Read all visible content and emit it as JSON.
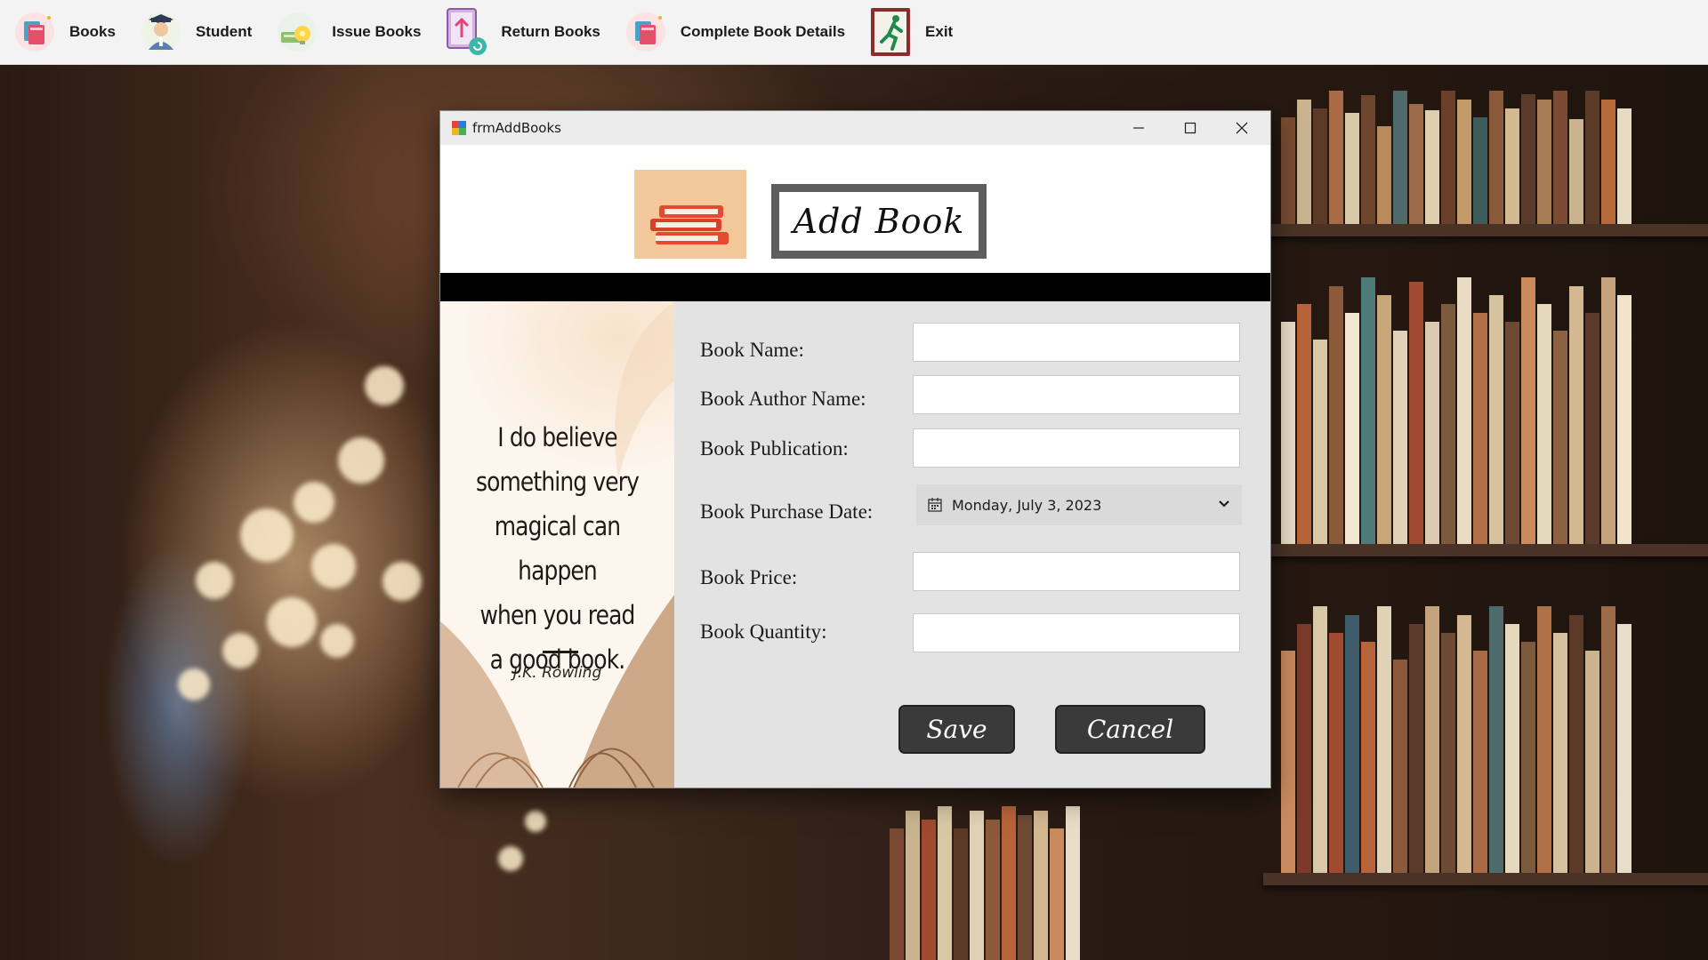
{
  "toolbar": {
    "items": [
      {
        "label": "Books",
        "icon": "books-icon"
      },
      {
        "label": "Student",
        "icon": "student-icon"
      },
      {
        "label": "Issue Books",
        "icon": "issue-books-icon"
      },
      {
        "label": "Return Books",
        "icon": "return-books-icon"
      },
      {
        "label": "Complete Book Details",
        "icon": "complete-book-details-icon"
      },
      {
        "label": "Exit",
        "icon": "exit-icon"
      }
    ]
  },
  "window": {
    "title": "frmAddBooks",
    "heading": "Add Book",
    "quote": {
      "lines": [
        "I do believe",
        "something very",
        "magical can happen",
        "when you read",
        "a good book."
      ],
      "author": "J.K. Rowling"
    },
    "form": {
      "book_name_label": "Book Name:",
      "book_name_value": "",
      "author_label": "Book Author Name:",
      "author_value": "",
      "publication_label": "Book Publication:",
      "publication_value": "",
      "purchase_date_label": "Book Purchase Date:",
      "purchase_date_value": "Monday, July 3, 2023",
      "price_label": "Book Price:",
      "price_value": "",
      "quantity_label": "Book Quantity:",
      "quantity_value": ""
    },
    "buttons": {
      "save": "Save",
      "cancel": "Cancel"
    }
  },
  "colors": {
    "toolbar_bg": "#f3f3f3",
    "window_bg": "#e3e3e3",
    "button_bg": "#3a3a3a",
    "title_border": "#5e5e5e",
    "logo_bg": "#f3c89a"
  }
}
